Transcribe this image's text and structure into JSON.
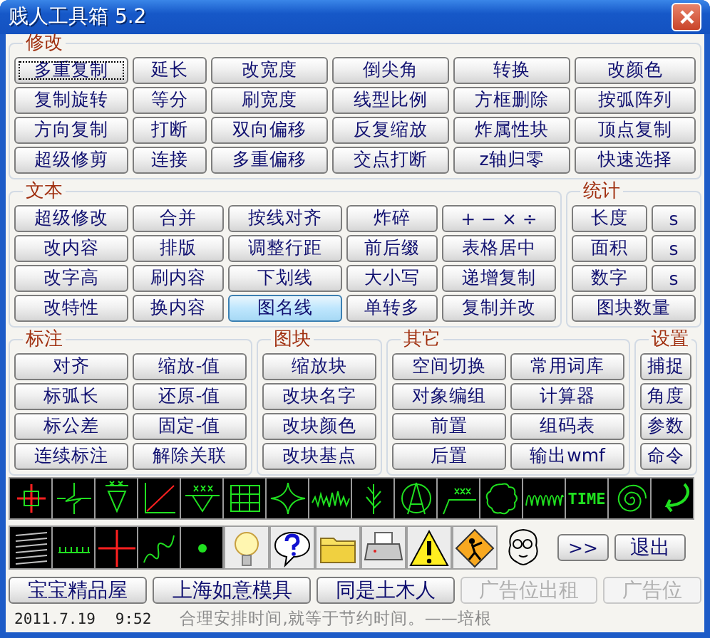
{
  "window": {
    "title": "贱人工具箱 5.2"
  },
  "modify": {
    "title": "修改",
    "rows": [
      [
        {
          "label": "多重复制",
          "focused": true,
          "hovered": false
        },
        {
          "label": "延长",
          "focused": false,
          "hovered": false
        },
        {
          "label": "改宽度",
          "focused": false,
          "hovered": false
        },
        {
          "label": "倒尖角",
          "focused": false,
          "hovered": false
        },
        {
          "label": "转换",
          "focused": false,
          "hovered": false
        },
        {
          "label": "改颜色",
          "focused": false,
          "hovered": false
        }
      ],
      [
        {
          "label": "复制旋转",
          "focused": false,
          "hovered": false
        },
        {
          "label": "等分",
          "focused": false,
          "hovered": false
        },
        {
          "label": "刷宽度",
          "focused": false,
          "hovered": false
        },
        {
          "label": "线型比例",
          "focused": false,
          "hovered": false
        },
        {
          "label": "方框删除",
          "focused": false,
          "hovered": false
        },
        {
          "label": "按弧阵列",
          "focused": false,
          "hovered": false
        }
      ],
      [
        {
          "label": "方向复制",
          "focused": false,
          "hovered": false
        },
        {
          "label": "打断",
          "focused": false,
          "hovered": false
        },
        {
          "label": "双向偏移",
          "focused": false,
          "hovered": false
        },
        {
          "label": "反复缩放",
          "focused": false,
          "hovered": false
        },
        {
          "label": "炸属性块",
          "focused": false,
          "hovered": false
        },
        {
          "label": "顶点复制",
          "focused": false,
          "hovered": false
        }
      ],
      [
        {
          "label": "超级修剪",
          "focused": false,
          "hovered": false
        },
        {
          "label": "连接",
          "focused": false,
          "hovered": false
        },
        {
          "label": "多重偏移",
          "focused": false,
          "hovered": false
        },
        {
          "label": "交点打断",
          "focused": false,
          "hovered": false
        },
        {
          "label": "z轴归零",
          "focused": false,
          "hovered": false
        },
        {
          "label": "快速选择",
          "focused": false,
          "hovered": false
        }
      ]
    ]
  },
  "text": {
    "title": "文本",
    "rows": [
      [
        {
          "label": "超级修改",
          "focused": false,
          "hovered": false
        },
        {
          "label": "合并",
          "focused": false,
          "hovered": false
        },
        {
          "label": "按线对齐",
          "focused": false,
          "hovered": false
        },
        {
          "label": "炸碎",
          "focused": false,
          "hovered": false
        },
        {
          "label": "+ − × ÷",
          "focused": false,
          "hovered": false
        }
      ],
      [
        {
          "label": "改内容",
          "focused": false,
          "hovered": false
        },
        {
          "label": "排版",
          "focused": false,
          "hovered": false
        },
        {
          "label": "调整行距",
          "focused": false,
          "hovered": false
        },
        {
          "label": "前后缀",
          "focused": false,
          "hovered": false
        },
        {
          "label": "表格居中",
          "focused": false,
          "hovered": false
        }
      ],
      [
        {
          "label": "改字高",
          "focused": false,
          "hovered": false
        },
        {
          "label": "刷内容",
          "focused": false,
          "hovered": false
        },
        {
          "label": "下划线",
          "focused": false,
          "hovered": false
        },
        {
          "label": "大小写",
          "focused": false,
          "hovered": false
        },
        {
          "label": "递增复制",
          "focused": false,
          "hovered": false
        }
      ],
      [
        {
          "label": "改特性",
          "focused": false,
          "hovered": false
        },
        {
          "label": "换内容",
          "focused": false,
          "hovered": false
        },
        {
          "label": "图名线",
          "focused": false,
          "hovered": true
        },
        {
          "label": "单转多",
          "focused": false,
          "hovered": false
        },
        {
          "label": "复制并改",
          "focused": false,
          "hovered": false
        }
      ]
    ]
  },
  "stats": {
    "title": "统计",
    "rows": [
      [
        {
          "label": "长度",
          "focused": false,
          "hovered": false
        },
        {
          "label": "s",
          "focused": false,
          "hovered": false
        }
      ],
      [
        {
          "label": "面积",
          "focused": false,
          "hovered": false
        },
        {
          "label": "s",
          "focused": false,
          "hovered": false
        }
      ],
      [
        {
          "label": "数字",
          "focused": false,
          "hovered": false
        },
        {
          "label": "s",
          "focused": false,
          "hovered": false
        }
      ],
      [
        {
          "label": "图块数量",
          "focused": false,
          "hovered": false
        }
      ]
    ]
  },
  "dimension": {
    "title": "标注",
    "rows": [
      [
        {
          "label": "对齐",
          "focused": false,
          "hovered": false
        },
        {
          "label": "缩放-值",
          "focused": false,
          "hovered": false
        }
      ],
      [
        {
          "label": "标弧长",
          "focused": false,
          "hovered": false
        },
        {
          "label": "还原-值",
          "focused": false,
          "hovered": false
        }
      ],
      [
        {
          "label": "标公差",
          "focused": false,
          "hovered": false
        },
        {
          "label": "固定-值",
          "focused": false,
          "hovered": false
        }
      ],
      [
        {
          "label": "连续标注",
          "focused": false,
          "hovered": false
        },
        {
          "label": "解除关联",
          "focused": false,
          "hovered": false
        }
      ]
    ]
  },
  "block": {
    "title": "图块",
    "rows": [
      [
        {
          "label": "缩放块",
          "focused": false,
          "hovered": false
        }
      ],
      [
        {
          "label": "改块名字",
          "focused": false,
          "hovered": false
        }
      ],
      [
        {
          "label": "改块颜色",
          "focused": false,
          "hovered": false
        }
      ],
      [
        {
          "label": "改块基点",
          "focused": false,
          "hovered": false
        }
      ]
    ]
  },
  "other": {
    "title": "其它",
    "rows": [
      [
        {
          "label": "空间切换",
          "focused": false,
          "hovered": false
        },
        {
          "label": "常用词库",
          "focused": false,
          "hovered": false
        }
      ],
      [
        {
          "label": "对象编组",
          "focused": false,
          "hovered": false
        },
        {
          "label": "计算器",
          "focused": false,
          "hovered": false
        }
      ],
      [
        {
          "label": "前置",
          "focused": false,
          "hovered": false
        },
        {
          "label": "组码表",
          "focused": false,
          "hovered": false
        }
      ],
      [
        {
          "label": "后置",
          "focused": false,
          "hovered": false
        },
        {
          "label": "输出wmf",
          "focused": false,
          "hovered": false
        }
      ]
    ]
  },
  "settings": {
    "title": "设置",
    "rows": [
      [
        {
          "label": "捕捉",
          "focused": false,
          "hovered": false
        }
      ],
      [
        {
          "label": "角度",
          "focused": false,
          "hovered": false
        }
      ],
      [
        {
          "label": "参数",
          "focused": false,
          "hovered": false
        }
      ],
      [
        {
          "label": "命令",
          "focused": false,
          "hovered": false
        }
      ]
    ]
  },
  "drawing_tools": [
    {
      "kind": "crosshair"
    },
    {
      "kind": "breakline"
    },
    {
      "kind": "weld"
    },
    {
      "kind": "diagonal"
    },
    {
      "kind": "roughness"
    },
    {
      "kind": "table"
    },
    {
      "kind": "star"
    },
    {
      "kind": "zigzag"
    },
    {
      "kind": "branch"
    },
    {
      "kind": "compass"
    },
    {
      "kind": "surface"
    },
    {
      "kind": "cloud"
    },
    {
      "kind": "squarewave"
    },
    {
      "kind": "time",
      "label": "TIME"
    },
    {
      "kind": "spiral"
    },
    {
      "kind": "curvedarrow"
    }
  ],
  "line_tools": [
    {
      "kind": "hatch"
    },
    {
      "kind": "ruler"
    },
    {
      "kind": "cross"
    },
    {
      "kind": "squiggle"
    },
    {
      "kind": "dot"
    }
  ],
  "utility_icons": [
    {
      "kind": "bulb"
    },
    {
      "kind": "help"
    },
    {
      "kind": "folder"
    },
    {
      "kind": "printer"
    },
    {
      "kind": "warning"
    },
    {
      "kind": "worker"
    },
    {
      "kind": "face"
    }
  ],
  "more_button": ">>",
  "exit_button": "退出",
  "ad_buttons": [
    {
      "label": "宝宝精品屋",
      "disabled": false
    },
    {
      "label": "上海如意模具",
      "disabled": false
    },
    {
      "label": "同是土木人",
      "disabled": false
    },
    {
      "label": "广告位出租",
      "disabled": true
    },
    {
      "label": "广告位",
      "disabled": true
    }
  ],
  "status": {
    "date": "2011.7.19",
    "time": "9:52",
    "quote": "合理安排时间,就等于节约时间。——培根"
  }
}
